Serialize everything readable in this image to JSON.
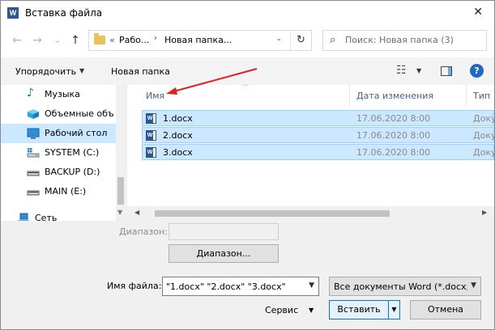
{
  "window": {
    "title": "Вставка файла",
    "app_icon": "W",
    "close": "✕"
  },
  "nav": {
    "back": "←",
    "forward": "→",
    "recent": "⌄",
    "up": "↑",
    "address": {
      "overflow": "«",
      "seg1": "Рабо...",
      "sep": "›",
      "seg2": "Новая папка...",
      "dropdown": "⌄",
      "refresh": "↻"
    },
    "search": {
      "icon": "⌕",
      "placeholder": "Поиск: Новая папка (3)"
    }
  },
  "toolbar": {
    "organize": "Упорядочить",
    "organize_drop": "▼",
    "new_folder": "Новая папка",
    "view": "☷",
    "view_drop": "▼",
    "help": "?"
  },
  "sidebar": {
    "items": [
      {
        "label": "Музыка",
        "icon": "♪"
      },
      {
        "label": "Объемные объ",
        "icon": ""
      },
      {
        "label": "Рабочий стол",
        "icon": ""
      },
      {
        "label": "SYSTEM (C:)",
        "icon": ""
      },
      {
        "label": "BACKUP (D:)",
        "icon": ""
      },
      {
        "label": "MAIN (E:)",
        "icon": ""
      },
      {
        "label": "Сеть",
        "icon": ""
      }
    ],
    "scroll_down": "▼"
  },
  "files": {
    "columns": {
      "name": "Имя",
      "date": "Дата изменения",
      "type": "Тип"
    },
    "sort_arrow": "^",
    "rows": [
      {
        "name": "1.docx",
        "date": "17.06.2020 8:00",
        "type": "Доку"
      },
      {
        "name": "2.docx",
        "date": "17.06.2020 8:00",
        "type": "Доку"
      },
      {
        "name": "3.docx",
        "date": "17.06.2020 8:00",
        "type": "Доку"
      }
    ],
    "hscroll_left": "◀",
    "hscroll_right": "▶"
  },
  "bottom": {
    "range_label": "Диапазон:",
    "range_button": "Диапазон...",
    "filename_label": "Имя файла:",
    "filename_value": "\"1.docx\" \"2.docx\" \"3.docx\"",
    "filename_drop": "▼",
    "filetype_value": "Все документы Word (*.docx;*",
    "filetype_drop": "▼",
    "service": "Сервис",
    "service_drop": "▼",
    "insert": "Вставить",
    "insert_drop": "▼",
    "cancel": "Отмена"
  },
  "colors": {
    "accent": "#0078d7",
    "selection": "#cce8ff",
    "annotation_arrow": "#e02020"
  }
}
